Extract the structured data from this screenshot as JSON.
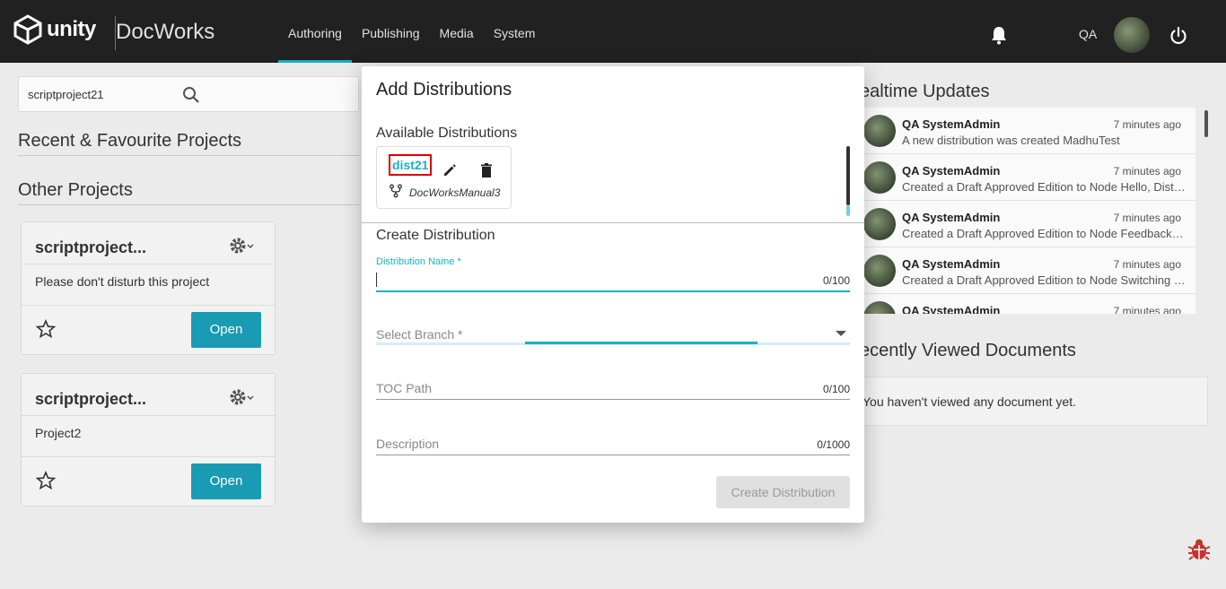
{
  "header": {
    "logo_text": "unity",
    "app_name": "DocWorks",
    "nav": [
      {
        "label": "Authoring",
        "active": true
      },
      {
        "label": "Publishing",
        "active": false
      },
      {
        "label": "Media",
        "active": false
      },
      {
        "label": "System",
        "active": false
      }
    ],
    "user_initials": "QA"
  },
  "left": {
    "search_value": "scriptproject21",
    "recent_title": "Recent & Favourite Projects",
    "other_title": "Other Projects",
    "projects": [
      {
        "title": "scriptproject...",
        "description": "Please don't disturb this project",
        "open_label": "Open"
      },
      {
        "title": "scriptproject...",
        "description": "Project2",
        "open_label": "Open"
      }
    ]
  },
  "right": {
    "updates_title": "ealtime Updates",
    "updates": [
      {
        "name": "QA SystemAdmin",
        "time": "7 minutes ago",
        "text": "A new distribution was created MadhuTest"
      },
      {
        "name": "QA SystemAdmin",
        "time": "7 minutes ago",
        "text": "Created a Draft Approved Edition to Node Hello, Distrib..."
      },
      {
        "name": "QA SystemAdmin",
        "time": "7 minutes ago",
        "text": "Created a Draft Approved Edition to Node Feedback, Di..."
      },
      {
        "name": "QA SystemAdmin",
        "time": "7 minutes ago",
        "text": "Created a Draft Approved Edition to Node Switching be..."
      },
      {
        "name": "QA SystemAdmin",
        "time": "7 minutes ago",
        "text": ""
      }
    ],
    "recent_docs_title": "ecently Viewed Documents",
    "recent_docs_empty": "You haven't viewed any document yet."
  },
  "dialog": {
    "title": "Add Distributions",
    "available_label": "Available Distributions",
    "distribution": {
      "name": "dist21",
      "branch": "DocWorksManual3"
    },
    "create_title": "Create Distribution",
    "fields": {
      "name_label": "Distribution Name *",
      "name_counter": "0/100",
      "branch_placeholder": "Select Branch *",
      "toc_placeholder": "TOC Path",
      "toc_counter": "0/100",
      "desc_placeholder": "Description",
      "desc_counter": "0/1000"
    },
    "create_button": "Create Distribution"
  },
  "colors": {
    "accent": "#1cb0c6",
    "topbar": "#222222",
    "open_button": "#1a9fb8",
    "highlight": "#dd0000"
  }
}
